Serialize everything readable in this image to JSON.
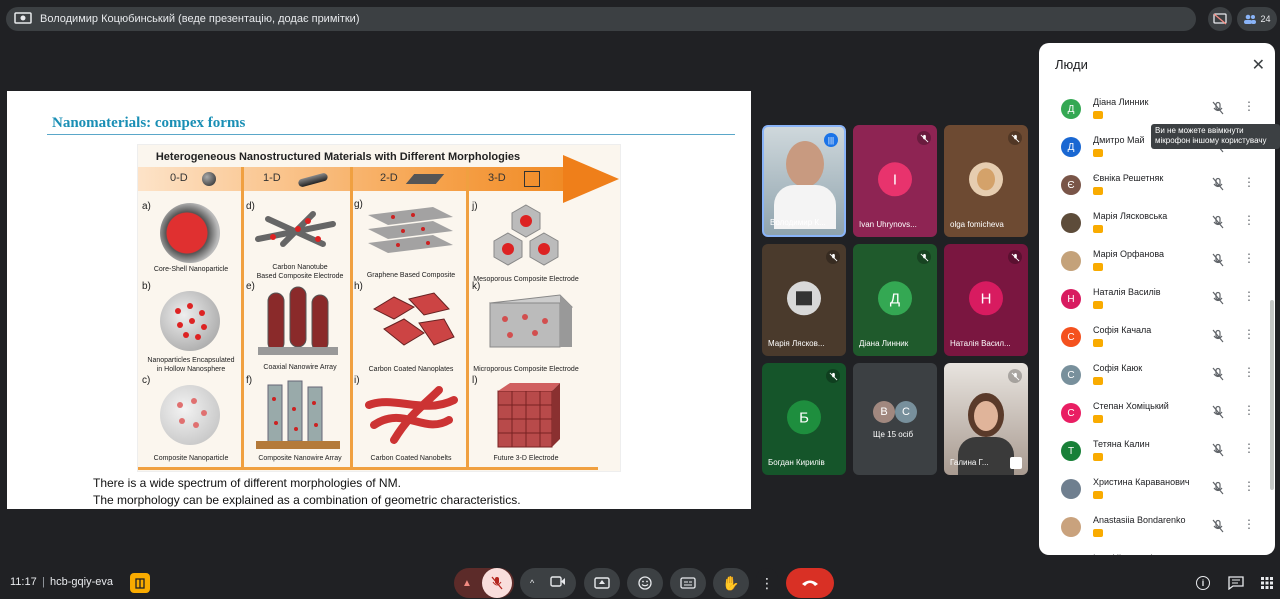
{
  "topbar": {
    "presenter_text": "Володимир Коцюбинський (веде презентацію, додає примітки)",
    "participant_count": "24"
  },
  "slide": {
    "title": "Nanomaterials: compex forms",
    "figure_heading": "Heterogeneous  Nanostructured Materials with Different Morphologies",
    "dimensions": [
      "0-D",
      "1-D",
      "2-D",
      "3-D"
    ],
    "cells": [
      {
        "letter": "a)",
        "caption": "Core-Shell Nanoparticle"
      },
      {
        "letter": "d)",
        "caption": "Carbon Nanotube\nBased Composite Electrode"
      },
      {
        "letter": "g)",
        "caption": "Graphene Based Composite"
      },
      {
        "letter": "j)",
        "caption": "Mesoporous Composite Electrode"
      },
      {
        "letter": "b)",
        "caption": "Nanoparticles Encapsulated\nin Hollow Nanosphere"
      },
      {
        "letter": "e)",
        "caption": "Coaxial Nanowire Array"
      },
      {
        "letter": "h)",
        "caption": "Carbon Coated Nanoplates"
      },
      {
        "letter": "k)",
        "caption": "Microporous Composite Electrode"
      },
      {
        "letter": "c)",
        "caption": "Composite Nanoparticle"
      },
      {
        "letter": "f)",
        "caption": "Composite Nanowire Array"
      },
      {
        "letter": "i)",
        "caption": "Carbon Coated Nanobelts"
      },
      {
        "letter": "l)",
        "caption": "Future 3-D Electrode"
      }
    ],
    "line1": "There is a wide spectrum of different morphologies of NM.",
    "line2": "The morphology can be explained as a combination of geometric characteristics."
  },
  "tiles": [
    {
      "name": "Володимир К...",
      "initial": "",
      "color": "#6b6f73"
    },
    {
      "name": "Ivan Uhrynovs...",
      "initial": "I",
      "color": "#e8336d"
    },
    {
      "name": "olga fomicheva",
      "initial": "",
      "color": "#d9b48a"
    },
    {
      "name": "Марія Лясков...",
      "initial": "",
      "color": "#5d4c3a"
    },
    {
      "name": "Діана Линник",
      "initial": "Д",
      "color": "#34a853"
    },
    {
      "name": "Наталія Васил...",
      "initial": "Н",
      "color": "#d81b60"
    },
    {
      "name": "Богдан Кирилів",
      "initial": "Б",
      "color": "#1e8e3e"
    },
    {
      "name": "Ще 15 осіб",
      "initial": "",
      "color": "#3c4043"
    },
    {
      "name": "Галина Г...",
      "initial": "",
      "color": "#b9a99b"
    }
  ],
  "more_avatars": [
    "В",
    "С"
  ],
  "people_panel": {
    "title": "Люди",
    "tooltip": "Ви не можете ввімкнути мікрофон іншому користувачу",
    "people": [
      {
        "name": "Діана Линник",
        "initial": "Д",
        "color": "#34a853"
      },
      {
        "name": "Дмитро Май",
        "initial": "Д",
        "color": "#1967d2"
      },
      {
        "name": "Євніка Решетняк",
        "initial": "Є",
        "color": "#795548"
      },
      {
        "name": "Марія Лясковська",
        "initial": "",
        "color": "#5d4c3a"
      },
      {
        "name": "Марія Орфанова",
        "initial": "",
        "color": "#c4a27a"
      },
      {
        "name": "Наталія Василів",
        "initial": "Н",
        "color": "#d81b60"
      },
      {
        "name": "Софія Качала",
        "initial": "С",
        "color": "#f4511e"
      },
      {
        "name": "Софія Каюк",
        "initial": "С",
        "color": "#78909c"
      },
      {
        "name": "Степан Хоміцький",
        "initial": "С",
        "color": "#e91e63"
      },
      {
        "name": "Тетяна Калин",
        "initial": "Т",
        "color": "#188038"
      },
      {
        "name": "Христина Караванович",
        "initial": "",
        "color": "#6f7f8f"
      },
      {
        "name": "Anastasiia Bondarenko",
        "initial": "",
        "color": "#c9a27d"
      },
      {
        "name": "Ivan Uhrynovskyy",
        "initial": "",
        "color": "#e8336d"
      }
    ]
  },
  "bottombar": {
    "time": "11:17",
    "separator": "|",
    "meeting_code": "hcb-gqiy-eva"
  }
}
